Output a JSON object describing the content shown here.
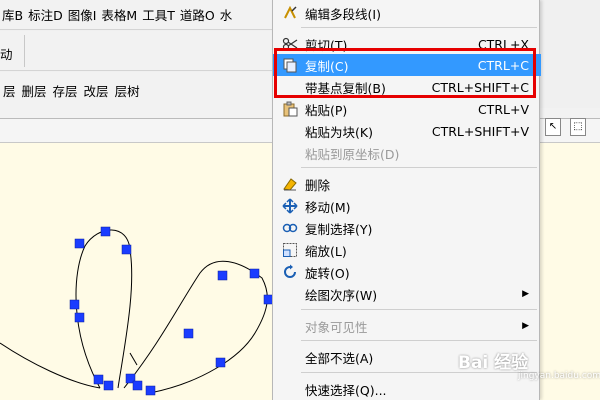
{
  "menubar": {
    "items": [
      "库B",
      "标注D",
      "图像I",
      "表格M",
      "工具T",
      "道路O",
      "水"
    ]
  },
  "toolbar1": {
    "label": "动"
  },
  "layer_toolbar": {
    "items": [
      "层",
      "删层",
      "存层",
      "改层",
      "层树"
    ]
  },
  "context_menu": {
    "items": [
      {
        "label": "编辑多段线(I)",
        "shortcut": "",
        "icon": "polyline-edit-icon",
        "disabled": false
      },
      {
        "label": "剪切(T)",
        "shortcut": "CTRL+X",
        "icon": "scissors-icon",
        "disabled": false
      },
      {
        "label": "复制(C)",
        "shortcut": "CTRL+C",
        "icon": "copy-icon",
        "disabled": false,
        "highlighted": true
      },
      {
        "label": "带基点复制(B)",
        "shortcut": "CTRL+SHIFT+C",
        "icon": "",
        "disabled": false
      },
      {
        "label": "粘贴(P)",
        "shortcut": "CTRL+V",
        "icon": "paste-icon",
        "disabled": false
      },
      {
        "label": "粘贴为块(K)",
        "shortcut": "CTRL+SHIFT+V",
        "icon": "",
        "disabled": false
      },
      {
        "label": "粘贴到原坐标(D)",
        "shortcut": "",
        "icon": "",
        "disabled": true
      },
      {
        "label": "删除",
        "shortcut": "",
        "icon": "eraser-icon",
        "disabled": false
      },
      {
        "label": "移动(M)",
        "shortcut": "",
        "icon": "move-icon",
        "disabled": false
      },
      {
        "label": "复制选择(Y)",
        "shortcut": "",
        "icon": "copy-select-icon",
        "disabled": false
      },
      {
        "label": "缩放(L)",
        "shortcut": "",
        "icon": "scale-icon",
        "disabled": false
      },
      {
        "label": "旋转(O)",
        "shortcut": "",
        "icon": "rotate-icon",
        "disabled": false
      },
      {
        "label": "绘图次序(W)",
        "shortcut": "",
        "icon": "",
        "disabled": false,
        "submenu": true
      },
      {
        "label": "对象可见性",
        "shortcut": "",
        "icon": "",
        "disabled": true,
        "submenu": true
      },
      {
        "label": "全部不选(A)",
        "shortcut": "",
        "icon": "",
        "disabled": false
      },
      {
        "label": "快速选择(Q)...",
        "shortcut": "",
        "icon": "",
        "disabled": false
      }
    ]
  },
  "watermark": {
    "text": "Bai 经验",
    "sub": "jingyan.baidu.com"
  },
  "colors": {
    "highlight": "#3399ff",
    "callout": "#e60000",
    "grip": "#1a3cff",
    "canvas": "#fffbe6"
  }
}
